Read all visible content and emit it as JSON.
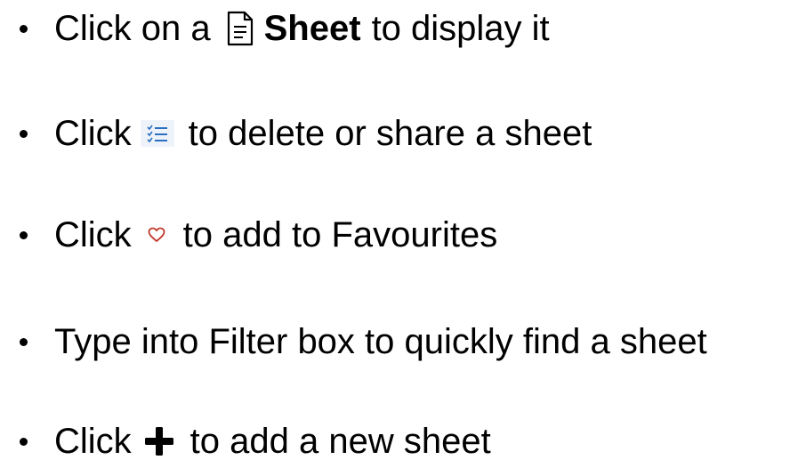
{
  "items": [
    {
      "prefix": "Click on a",
      "icon": "sheet-document-icon",
      "bold": "Sheet",
      "suffix": "to display it"
    },
    {
      "prefix": "Click",
      "icon": "checklist-menu-icon",
      "suffix": "to delete or share a sheet"
    },
    {
      "prefix": "Click",
      "icon": "heart-icon",
      "suffix": "to add to Favourites"
    },
    {
      "text": "Type into Filter box to quickly find a sheet"
    },
    {
      "prefix": "Click",
      "icon": "plus-icon",
      "suffix": "to add a new sheet"
    }
  ],
  "colors": {
    "text": "#000000",
    "list_icon": "#2a6fc2",
    "list_icon_bg": "#eef3fa",
    "heart": "#c0392b"
  }
}
